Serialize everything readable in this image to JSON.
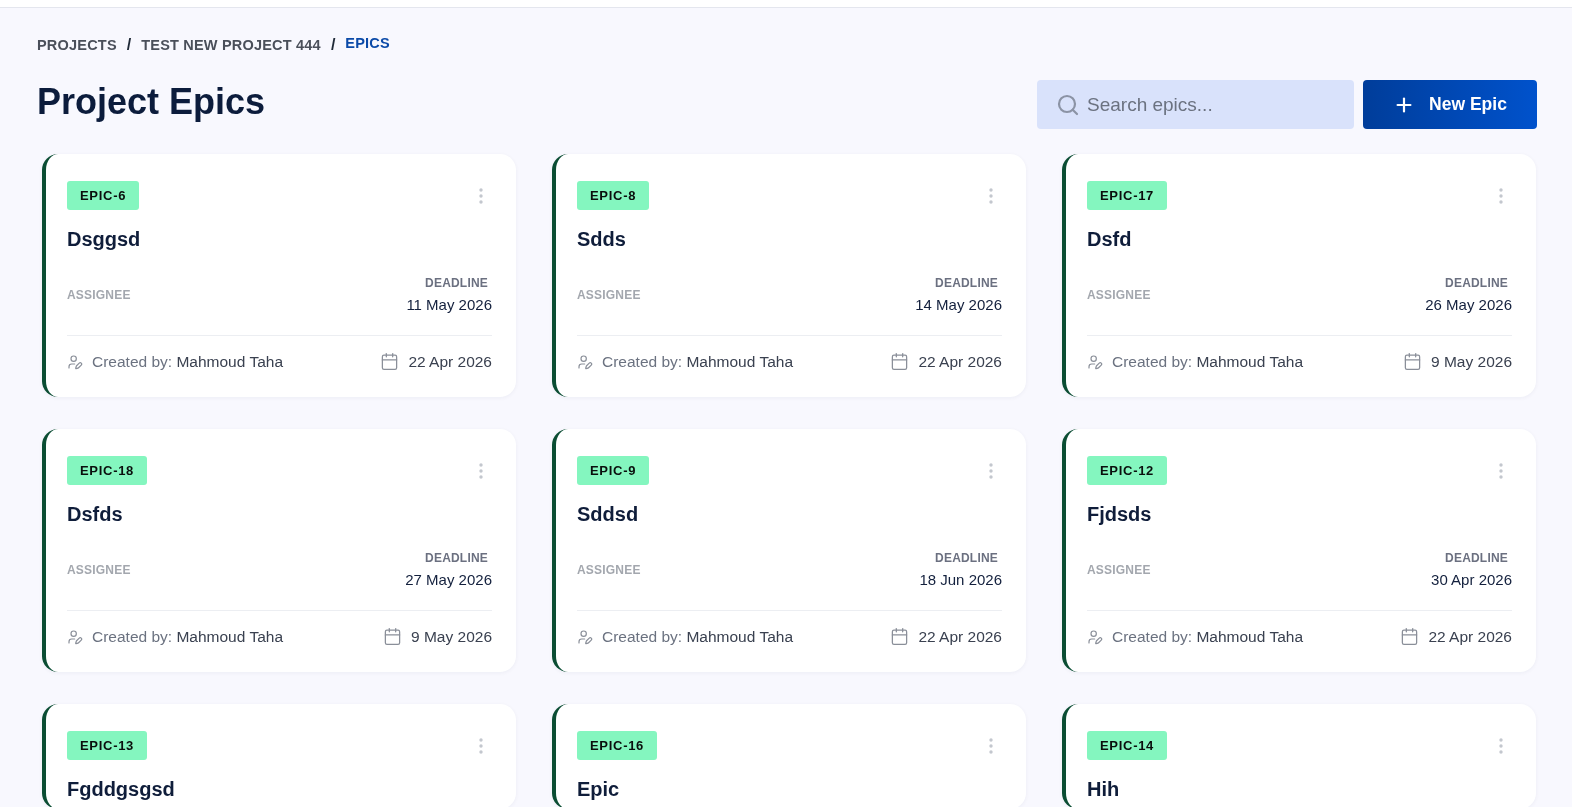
{
  "breadcrumb": [
    {
      "label": "PROJECTS",
      "current": false,
      "separator_after": "/"
    },
    {
      "label": "TEST NEW PROJECT 444",
      "current": false,
      "separator_after": "/"
    },
    {
      "label": "EPICS",
      "current": true
    }
  ],
  "title": "Project Epics",
  "search": {
    "placeholder": "Search epics..."
  },
  "new_button": {
    "label": "New Epic"
  },
  "epics": [
    {
      "key": "EPIC-6",
      "name": "Dsggsd",
      "assignee_label": "ASSIGNEE",
      "deadline_label": "DEADLINE",
      "deadline": "11 May 2026",
      "created_by": "Created by: **Mahmoud Taha**",
      "created": "22 Apr 2026"
    },
    {
      "key": "EPIC-8",
      "name": "Sdds",
      "assignee_label": "ASSIGNEE",
      "deadline_label": "DEADLINE",
      "deadline": "14 May 2026",
      "created_by": "Created by: **Mahmoud Taha**",
      "created": "22 Apr 2026"
    },
    {
      "key": "EPIC-17",
      "name": "Dsfd",
      "assignee_label": "ASSIGNEE",
      "deadline_label": "DEADLINE",
      "deadline": "26 May 2026",
      "created_by": "Created by: **Mahmoud Taha**",
      "created": "9 May 2026"
    },
    {
      "key": "EPIC-18",
      "name": "Dsfds",
      "assignee_label": "ASSIGNEE",
      "deadline_label": "DEADLINE",
      "deadline": "27 May 2026",
      "created_by": "Created by: **Mahmoud Taha**",
      "created": "9 May 2026"
    },
    {
      "key": "EPIC-9",
      "name": "Sddsd",
      "assignee_label": "ASSIGNEE",
      "deadline_label": "DEADLINE",
      "deadline": "18 Jun 2026",
      "created_by": "Created by: **Mahmoud Taha**",
      "created": "22 Apr 2026"
    },
    {
      "key": "EPIC-12",
      "name": "Fjdsds",
      "assignee_label": "ASSIGNEE",
      "deadline_label": "DEADLINE",
      "deadline": "30 Apr 2026",
      "created_by": "Created by: **Mahmoud Taha**",
      "created": "22 Apr 2026"
    },
    {
      "key": "EPIC-13",
      "name": "Fgddgsgsd"
    },
    {
      "key": "EPIC-16",
      "name": "Epic"
    },
    {
      "key": "EPIC-14",
      "name": "Hih"
    }
  ]
}
